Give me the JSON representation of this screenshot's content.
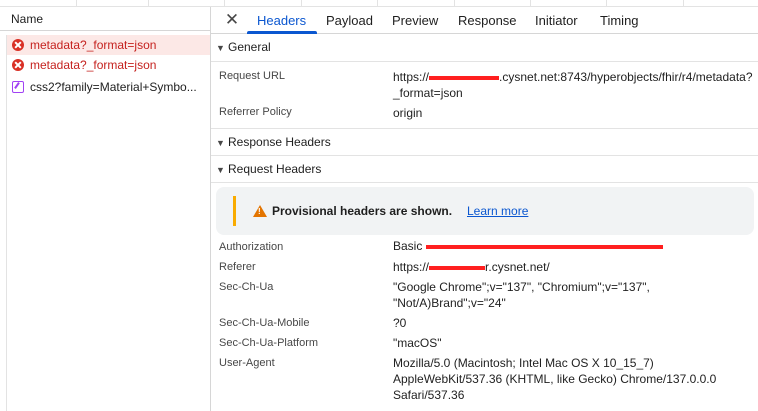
{
  "colors": {
    "accent": "#0b57d0",
    "error": "#d93025",
    "redaction": "#ff1f1f",
    "warning": "#f9ab00"
  },
  "request_list": {
    "header": "Name",
    "rows": [
      {
        "label": "metadata?_format=json",
        "icon": "error-icon",
        "status": "error"
      },
      {
        "label": "metadata?_format=json",
        "icon": "error-icon",
        "status": "error"
      },
      {
        "label": "css2?family=Material+Symbo...",
        "icon": "stylesheet-icon",
        "status": "ok"
      }
    ]
  },
  "tabs": {
    "close_icon": "close-icon",
    "close_glyph": "✕",
    "items": [
      "Headers",
      "Payload",
      "Preview",
      "Response",
      "Initiator",
      "Timing"
    ],
    "active": "Headers"
  },
  "general": {
    "title": "General",
    "request_url_key": "Request URL",
    "request_url_prefix": "https://",
    "request_url_suffix": ".cysnet.net:8743/hyperobjects/fhir/r4/metadata?_format=json",
    "referrer_policy_key": "Referrer Policy",
    "referrer_policy_value": "origin"
  },
  "response_headers": {
    "title": "Response Headers"
  },
  "request_headers": {
    "title": "Request Headers",
    "warning_icon": "warning-icon",
    "warning_text": "Provisional headers are shown.",
    "learn_more": "Learn more",
    "authorization_key": "Authorization",
    "authorization_value": "Basic ",
    "referer_key": "Referer",
    "referer_prefix": "https://",
    "referer_suffix": "r.cysnet.net/",
    "sec_ch_ua_key": "Sec-Ch-Ua",
    "sec_ch_ua_value": "\"Google Chrome\";v=\"137\", \"Chromium\";v=\"137\", \"Not/A)Brand\";v=\"24\"",
    "sec_ch_ua_mobile_key": "Sec-Ch-Ua-Mobile",
    "sec_ch_ua_mobile_value": "?0",
    "sec_ch_ua_platform_key": "Sec-Ch-Ua-Platform",
    "sec_ch_ua_platform_value": "\"macOS\"",
    "user_agent_key": "User-Agent",
    "user_agent_value": "Mozilla/5.0 (Macintosh; Intel Mac OS X 10_15_7) AppleWebKit/537.36 (KHTML, like Gecko) Chrome/137.0.0.0 Safari/537.36"
  }
}
